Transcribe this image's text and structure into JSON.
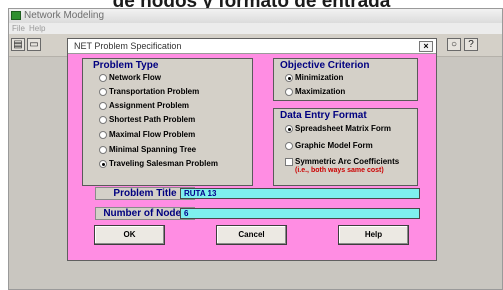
{
  "caption": "de nodos y formato de entrada",
  "app": {
    "title": "Network Modeling",
    "menu": [
      "File",
      "Help"
    ],
    "toolbar_icons": [
      "open-icon",
      "save-icon"
    ],
    "right_icons": [
      "close-icon",
      "help-icon"
    ]
  },
  "dialog": {
    "title": "NET Problem Specification",
    "close_label": "×",
    "problem_type": {
      "title": "Problem Type",
      "options": [
        {
          "label": "Network Flow",
          "selected": false
        },
        {
          "label": "Transportation Problem",
          "selected": false
        },
        {
          "label": "Assignment Problem",
          "selected": false
        },
        {
          "label": "Shortest Path Problem",
          "selected": false
        },
        {
          "label": "Maximal Flow Problem",
          "selected": false
        },
        {
          "label": "Minimal Spanning Tree",
          "selected": false
        },
        {
          "label": "Traveling Salesman Problem",
          "selected": true
        }
      ]
    },
    "objective": {
      "title": "Objective Criterion",
      "options": [
        {
          "label": "Minimization",
          "selected": true
        },
        {
          "label": "Maximization",
          "selected": false
        }
      ]
    },
    "data_entry": {
      "title": "Data Entry Format",
      "options": [
        {
          "label": "Spreadsheet Matrix Form",
          "selected": true
        },
        {
          "label": "Graphic Model Form",
          "selected": false
        }
      ],
      "checkbox_label": "Symmetric Arc Coefficients",
      "checkbox_checked": false,
      "note": "(i.e., both ways same cost)"
    },
    "problem_title": {
      "label": "Problem Title",
      "value": "RUTA 13"
    },
    "number_of_nodes": {
      "label": "Number of Nodes",
      "value": "6"
    },
    "buttons": {
      "ok": "OK",
      "cancel": "Cancel",
      "help": "Help"
    }
  }
}
